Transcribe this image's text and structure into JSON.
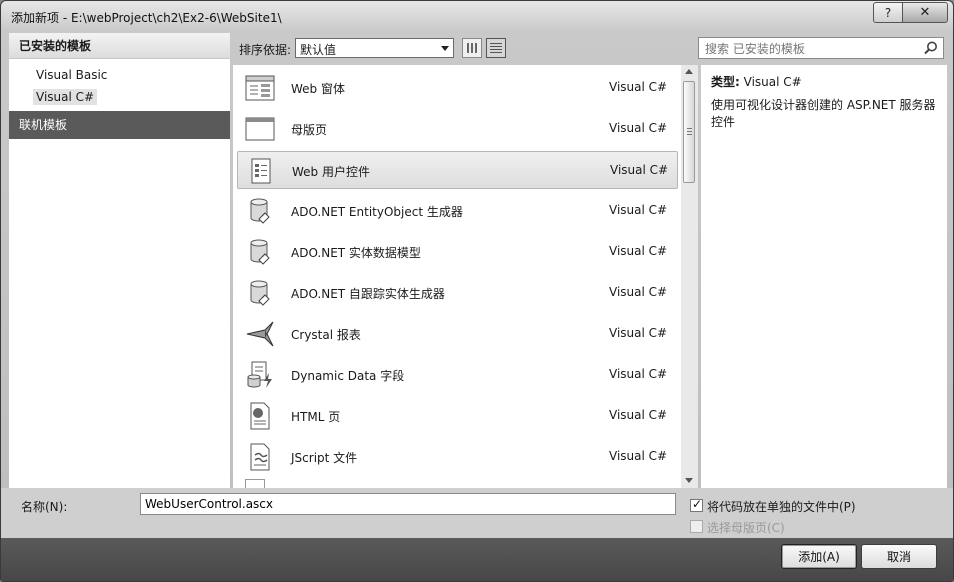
{
  "window": {
    "title": "添加新项 - E:\\webProject\\ch2\\Ex2-6\\WebSite1\\",
    "help_label": "?",
    "close_label": "✕"
  },
  "left": {
    "installed_header": "已安装的模板",
    "languages": [
      "Visual Basic",
      "Visual C#"
    ],
    "selected_language": "Visual C#",
    "online_header": "联机模板"
  },
  "sort": {
    "label": "排序依据:",
    "value": "默认值"
  },
  "search": {
    "placeholder": "搜索 已安装的模板"
  },
  "templates": [
    {
      "name": "Web 窗体",
      "lang": "Visual C#",
      "icon": "webform-icon"
    },
    {
      "name": "母版页",
      "lang": "Visual C#",
      "icon": "masterpage-icon"
    },
    {
      "name": "Web 用户控件",
      "lang": "Visual C#",
      "icon": "usercontrol-icon",
      "selected": true
    },
    {
      "name": "ADO.NET EntityObject 生成器",
      "lang": "Visual C#",
      "icon": "database-icon"
    },
    {
      "name": "ADO.NET 实体数据模型",
      "lang": "Visual C#",
      "icon": "database-icon"
    },
    {
      "name": "ADO.NET 自跟踪实体生成器",
      "lang": "Visual C#",
      "icon": "database-icon"
    },
    {
      "name": "Crystal 报表",
      "lang": "Visual C#",
      "icon": "crystal-report-icon"
    },
    {
      "name": "Dynamic Data 字段",
      "lang": "Visual C#",
      "icon": "dynamic-data-icon"
    },
    {
      "name": "HTML 页",
      "lang": "Visual C#",
      "icon": "html-page-icon"
    },
    {
      "name": "JScript 文件",
      "lang": "Visual C#",
      "icon": "jscript-file-icon"
    }
  ],
  "detail": {
    "type_label": "类型:",
    "type_value": "Visual C#",
    "description": "使用可视化设计器创建的 ASP.NET 服务器控件"
  },
  "bottom": {
    "name_label": "名称(N):",
    "name_value": "WebUserControl.ascx",
    "separate_file_label": "将代码放在单独的文件中(P)",
    "separate_file_checked": true,
    "master_page_label": "选择母版页(C)",
    "master_page_checked": false
  },
  "buttons": {
    "add": "添加(A)",
    "cancel": "取消"
  }
}
